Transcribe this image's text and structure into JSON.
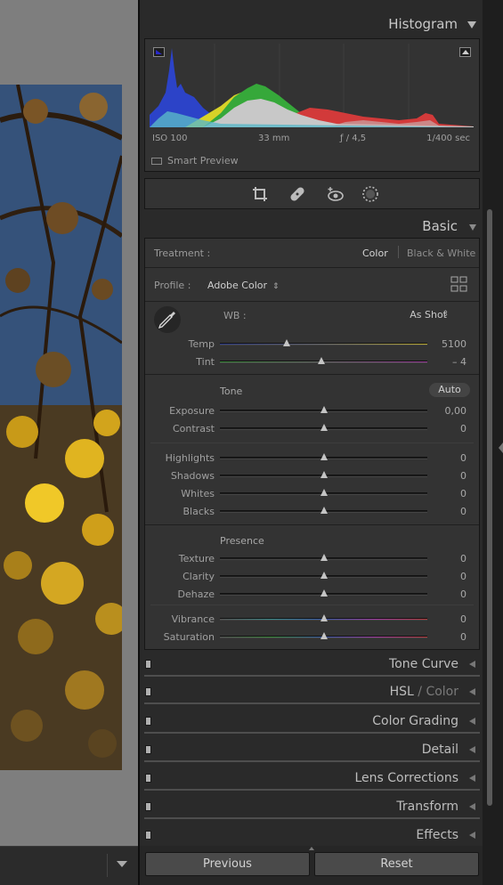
{
  "histogram": {
    "title": "Histogram",
    "iso": "ISO 100",
    "focal_length": "33 mm",
    "aperture": "ƒ / 4,5",
    "shutter": "1/400 sec",
    "smart_preview": "Smart Preview"
  },
  "tools": [
    "crop-icon",
    "healing-icon",
    "red-eye-icon",
    "masking-icon"
  ],
  "basic": {
    "title": "Basic",
    "treatment_label": "Treatment :",
    "treatment_color": "Color",
    "treatment_bw": "Black & White",
    "profile_label": "Profile :",
    "profile_value": "Adobe Color",
    "wb_label": "WB :",
    "wb_value": "As Shot",
    "temp": {
      "label": "Temp",
      "value": "5100",
      "pos": 0.32
    },
    "tint": {
      "label": "Tint",
      "value": "– 4",
      "pos": 0.49
    },
    "tone_label": "Tone",
    "auto_label": "Auto",
    "exposure": {
      "label": "Exposure",
      "value": "0,00",
      "pos": 0.5
    },
    "contrast": {
      "label": "Contrast",
      "value": "0",
      "pos": 0.5
    },
    "highlights": {
      "label": "Highlights",
      "value": "0",
      "pos": 0.5
    },
    "shadows": {
      "label": "Shadows",
      "value": "0",
      "pos": 0.5
    },
    "whites": {
      "label": "Whites",
      "value": "0",
      "pos": 0.5
    },
    "blacks": {
      "label": "Blacks",
      "value": "0",
      "pos": 0.5
    },
    "presence_label": "Presence",
    "texture": {
      "label": "Texture",
      "value": "0",
      "pos": 0.5
    },
    "clarity": {
      "label": "Clarity",
      "value": "0",
      "pos": 0.5
    },
    "dehaze": {
      "label": "Dehaze",
      "value": "0",
      "pos": 0.5
    },
    "vibrance": {
      "label": "Vibrance",
      "value": "0",
      "pos": 0.5
    },
    "saturation": {
      "label": "Saturation",
      "value": "0",
      "pos": 0.5
    }
  },
  "panels": {
    "tone_curve": "Tone Curve",
    "hsl": "HSL",
    "hsl_sep": " / ",
    "hsl_color": "Color",
    "color_grading": "Color Grading",
    "detail": "Detail",
    "lens_corrections": "Lens Corrections",
    "transform": "Transform",
    "effects": "Effects"
  },
  "buttons": {
    "previous": "Previous",
    "reset": "Reset"
  },
  "colors": {
    "panel_bg": "#2a2a2a",
    "section_bg": "#333333",
    "canvas_bg": "#7e7e7e"
  }
}
